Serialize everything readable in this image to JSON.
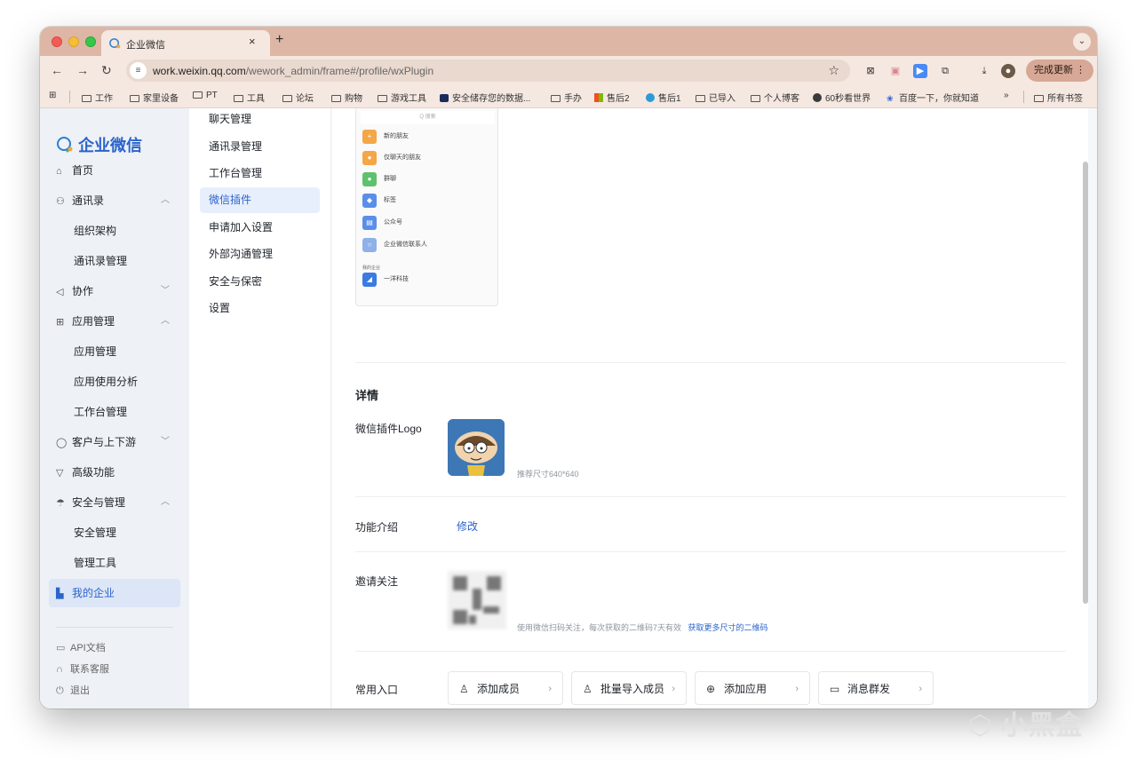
{
  "browser": {
    "tab_title": "企业微信",
    "tab_close": "×",
    "new_tab": "+",
    "url_host": "work.weixin.qq.com",
    "url_path": "/wework_admin/frame#/profile/wxPlugin",
    "update_button": "完成更新 ⋮",
    "bookmarks": [
      "工作",
      "家里设备",
      "PT",
      "工具",
      "论坛",
      "购物",
      "游戏工具",
      "安全储存您的数据...",
      "手办",
      "售后2",
      "售后1",
      "已导入",
      "个人博客",
      "60秒看世界",
      "百度一下，你就知道",
      "»",
      "所有书签"
    ]
  },
  "sidebar": {
    "logo": "企业微信",
    "items": [
      {
        "label": "首页",
        "icon": "home-icon"
      },
      {
        "label": "通讯录",
        "icon": "org-icon",
        "chevron": "^"
      },
      {
        "label": "组织架构"
      },
      {
        "label": "通讯录管理"
      },
      {
        "label": "协作",
        "icon": "collab-icon",
        "chevron": "v"
      },
      {
        "label": "应用管理",
        "icon": "grid-icon",
        "chevron": "^"
      },
      {
        "label": "应用管理"
      },
      {
        "label": "应用使用分析"
      },
      {
        "label": "工作台管理"
      },
      {
        "label": "客户与上下游",
        "icon": "chat-icon",
        "chevron": "v"
      },
      {
        "label": "高级功能",
        "icon": "triangle-icon"
      },
      {
        "label": "安全与管理",
        "icon": "umbrella-icon",
        "chevron": "^"
      },
      {
        "label": "安全管理"
      },
      {
        "label": "管理工具"
      },
      {
        "label": "我的企业",
        "icon": "company-icon"
      }
    ],
    "footer": [
      {
        "label": "API文档",
        "icon": "doc-icon"
      },
      {
        "label": "联系客服",
        "icon": "headset-icon"
      },
      {
        "label": "退出",
        "icon": "power-icon"
      }
    ]
  },
  "subnav": {
    "items": [
      "聊天管理",
      "通讯录管理",
      "工作台管理",
      "微信插件",
      "申请加入设置",
      "外部沟通管理",
      "安全与保密",
      "设置"
    ],
    "active": "微信插件"
  },
  "preview": {
    "search": "Q 搜索",
    "rows": [
      "新的朋友",
      "仅聊天的朋友",
      "群聊",
      "标签",
      "公众号",
      "企业微信联系人"
    ],
    "group_label": "我的企业",
    "company": "一洋科技"
  },
  "details": {
    "title": "详情",
    "logo_label": "微信插件Logo",
    "logo_hint": "推荐尺寸640*640",
    "intro_label": "功能介绍",
    "intro_action": "修改",
    "invite_label": "邀请关注",
    "invite_hint": "使用微信扫码关注，每次获取的二维码7天有效",
    "invite_link": "获取更多尺寸的二维码",
    "entry_label": "常用入口",
    "entries": [
      {
        "label": "添加成员",
        "icon": "add-member-icon"
      },
      {
        "label": "批量导入成员",
        "icon": "import-members-icon"
      },
      {
        "label": "添加应用",
        "icon": "add-app-icon"
      },
      {
        "label": "消息群发",
        "icon": "broadcast-icon"
      }
    ]
  },
  "watermark": "小黑盒",
  "colors": {
    "accent": "#2a63c9",
    "tabbar": "#ddb6a5",
    "toolbar": "#f5e8e1"
  }
}
